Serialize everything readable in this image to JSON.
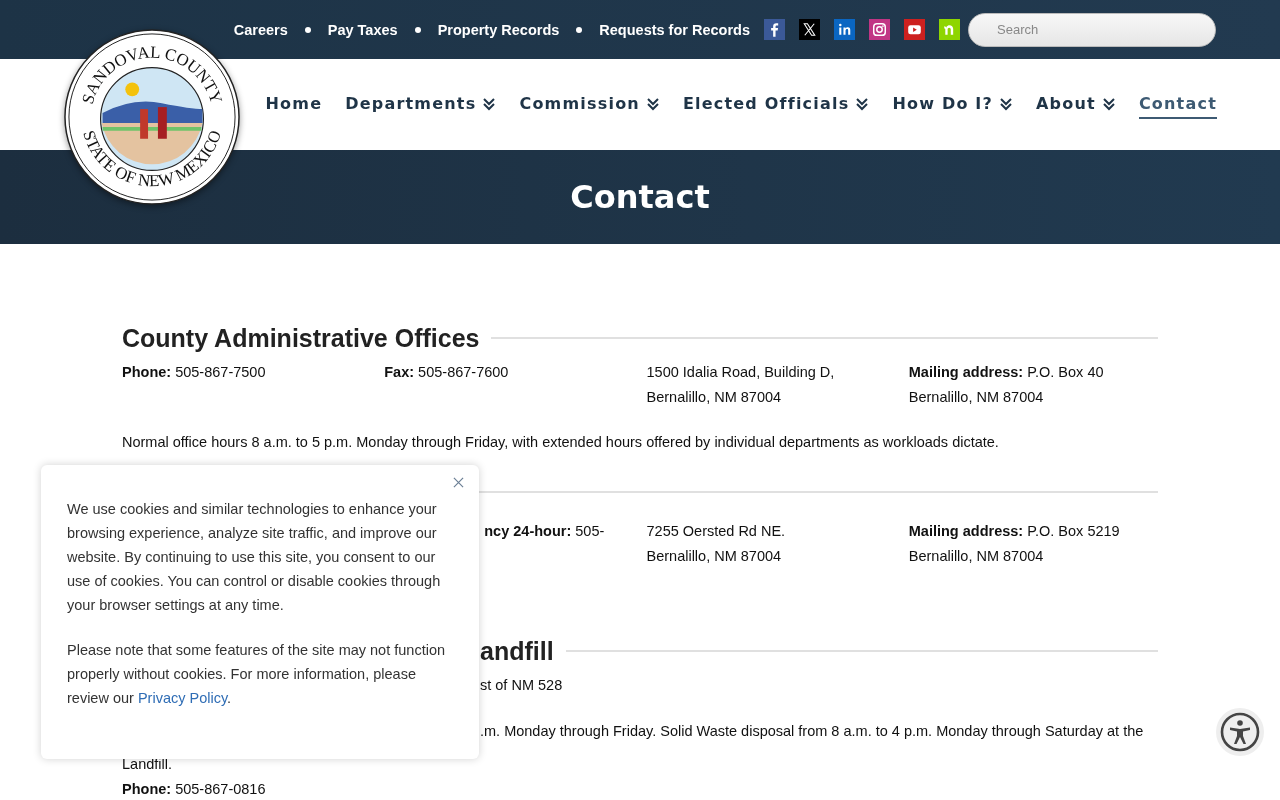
{
  "top_links": [
    "Careers",
    "Pay Taxes",
    "Property Records",
    "Requests for Records"
  ],
  "social": [
    {
      "kind": "facebook"
    },
    {
      "kind": "x"
    },
    {
      "kind": "linkedin"
    },
    {
      "kind": "instagram"
    },
    {
      "kind": "youtube"
    },
    {
      "kind": "nextdoor"
    }
  ],
  "search": {
    "placeholder": "Search"
  },
  "seal": {
    "top_text": "SANDOVAL COUNTY",
    "bottom_text": "STATE OF NEW MEXICO"
  },
  "nav": [
    {
      "label": "Home",
      "dropdown": false,
      "selected": false
    },
    {
      "label": "Departments",
      "dropdown": true,
      "selected": false
    },
    {
      "label": "Commission",
      "dropdown": true,
      "selected": false
    },
    {
      "label": "Elected Officials",
      "dropdown": true,
      "selected": false
    },
    {
      "label": "How Do I?",
      "dropdown": true,
      "selected": false
    },
    {
      "label": "About",
      "dropdown": true,
      "selected": false
    },
    {
      "label": "Contact",
      "dropdown": false,
      "selected": true
    }
  ],
  "page_title": "Contact",
  "sections": [
    {
      "kind": "full",
      "heading": "County Administrative Offices",
      "columns": [
        [
          "**Phone:** 505-867-7500"
        ],
        [
          "**Fax:** 505-867-7600"
        ],
        [
          "1500 Idalia Road, Building D,",
          "Bernalillo, NM 87004"
        ],
        [
          "**Mailing address:** P.O. Box 40",
          "Bernalillo, NM 87004"
        ]
      ],
      "lines": [
        "Normal office hours 8 a.m. to 5 p.m. Monday through Friday, with extended hours offered by individual departments as workloads dictate."
      ]
    },
    {
      "kind": "covered",
      "columns": [
        [
          "**ncy 24-hour:** 505-"
        ],
        [
          "7255 Oersted Rd NE.",
          "Bernalillo, NM 87004"
        ],
        [
          "**Mailing address:** P.O. Box 5219",
          "Bernalillo, NM 87004"
        ]
      ]
    },
    {
      "kind": "covered",
      "heading": "andfill",
      "partial_lines": [
        "st of NM 528",
        ".m. Monday through Friday. Solid Waste disposal from 8 a.m. to 4 p.m. Monday through Saturday at the"
      ],
      "lines": [
        "Landfill.",
        "**Phone:** 505-867-0816"
      ]
    }
  ],
  "cookie_notice": {
    "paragraph": "We use cookies and similar technologies to enhance your browsing experience, analyze site traffic, and improve our website. By continuing to use this site, you consent to our use of cookies. You can control or disable cookies through your browser settings at any time.",
    "note": "Please note that some features of the site may not function properly without cookies. For more information, please review our",
    "link": "Privacy Policy",
    "note_end": "."
  }
}
